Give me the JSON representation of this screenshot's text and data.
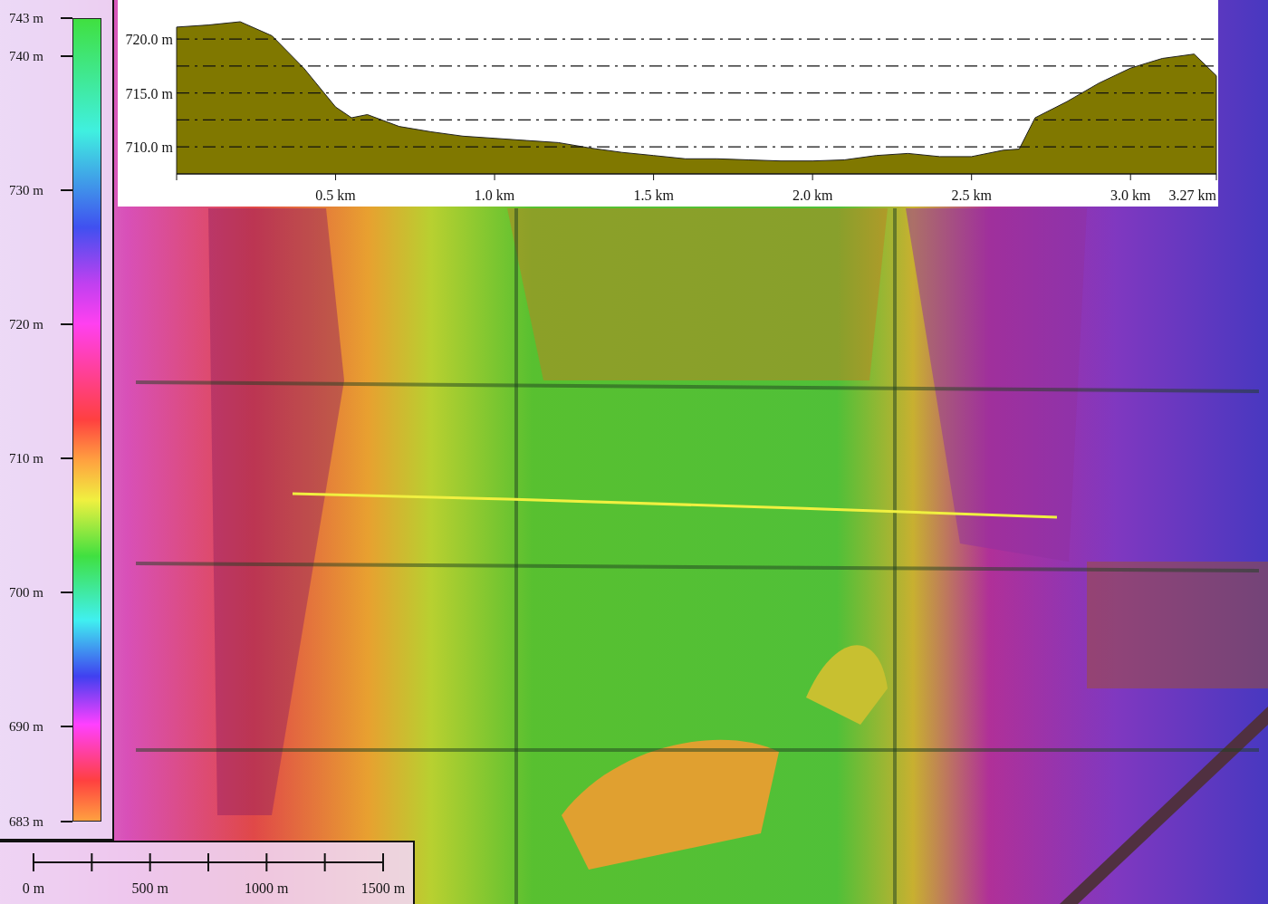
{
  "legend": {
    "labels": [
      "743 m",
      "740 m",
      "730 m",
      "720 m",
      "710 m",
      "700 m",
      "690 m",
      "683 m"
    ]
  },
  "profile": {
    "chart_data": {
      "type": "area",
      "x": [
        0,
        0.1,
        0.2,
        0.3,
        0.4,
        0.5,
        0.55,
        0.6,
        0.7,
        0.8,
        0.9,
        1.0,
        1.1,
        1.2,
        1.3,
        1.4,
        1.5,
        1.6,
        1.7,
        1.8,
        1.9,
        2.0,
        2.1,
        2.2,
        2.3,
        2.4,
        2.5,
        2.6,
        2.65,
        2.7,
        2.8,
        2.9,
        3.0,
        3.1,
        3.2,
        3.27
      ],
      "grid": true,
      "series": [
        {
          "color": "#807800",
          "values": [
            721.1,
            721.3,
            721.6,
            720.3,
            717.3,
            713.7,
            712.7,
            713.0,
            711.9,
            711.4,
            711.0,
            710.8,
            710.6,
            710.4,
            709.9,
            709.5,
            709.2,
            708.9,
            708.9,
            708.8,
            708.7,
            708.7,
            708.8,
            709.2,
            709.4,
            709.1,
            709.1,
            709.7,
            709.8,
            712.7,
            714.2,
            715.9,
            717.3,
            718.2,
            718.6,
            716.6
          ]
        }
      ],
      "xlim": [
        0,
        3.27
      ],
      "ylim": [
        707.5,
        723.6
      ],
      "xticks": [
        {
          "value": 0.5,
          "label": "0.5 km"
        },
        {
          "value": 1.0,
          "label": "1.0 km"
        },
        {
          "value": 1.5,
          "label": "1.5 km"
        },
        {
          "value": 2.0,
          "label": "2.0 km"
        },
        {
          "value": 2.5,
          "label": "2.5 km"
        },
        {
          "value": 3.0,
          "label": "3.0 km"
        },
        {
          "value": 3.27,
          "label": "3.27 km"
        }
      ],
      "yticks": [
        {
          "value": 710,
          "label": "710.0 m"
        },
        {
          "value": 715,
          "label": "715.0 m"
        },
        {
          "value": 720,
          "label": "720.0 m"
        }
      ]
    }
  },
  "scale_bar": {
    "labels": [
      "0 m",
      "500 m",
      "1000 m",
      "1500 m"
    ]
  }
}
